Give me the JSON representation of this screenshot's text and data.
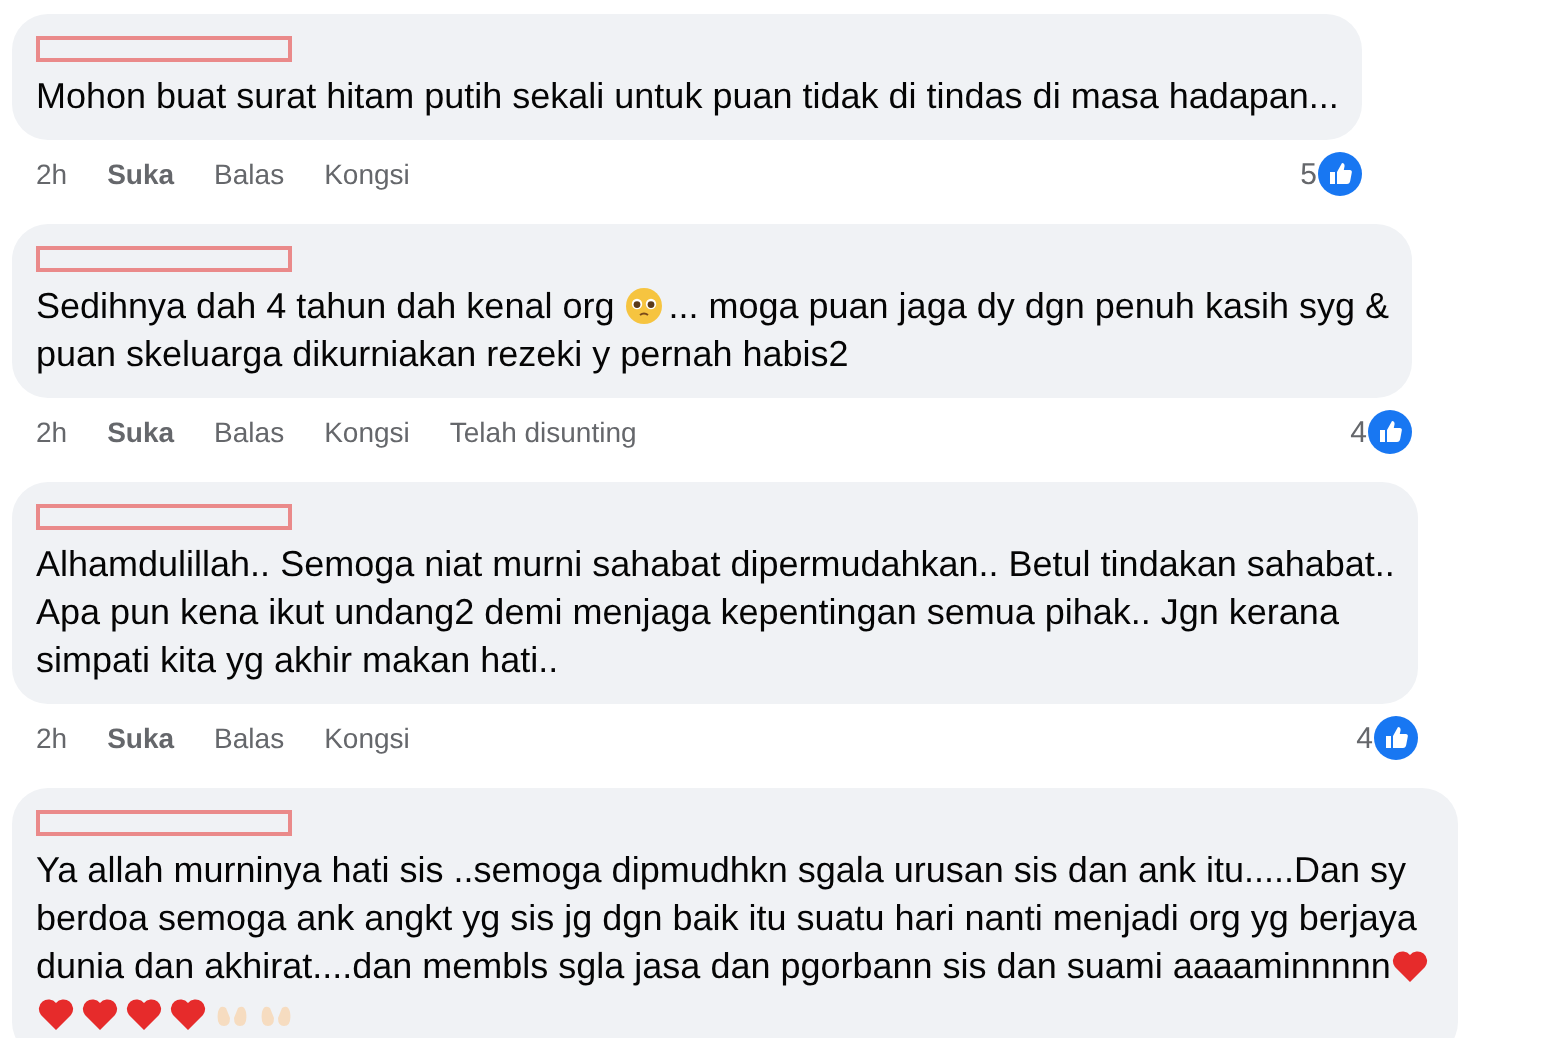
{
  "comments": [
    {
      "lines": [
        [
          {
            "kind": "text",
            "text": "Mohon buat surat hitam putih sekali untuk puan tidak di tindas di masa hadapan..."
          }
        ]
      ],
      "time": "2h",
      "actions": [
        "Suka",
        "Balas",
        "Kongsi"
      ],
      "reaction_count": "5"
    },
    {
      "lines": [
        [
          {
            "kind": "text",
            "text": "Sedihnya dah 4 tahun dah kenal org"
          },
          {
            "kind": "pleading-emoji"
          },
          {
            "kind": "text",
            "text": "... moga puan jaga dy dgn penuh kasih syg &"
          }
        ],
        [
          {
            "kind": "text",
            "text": "puan skeluarga dikurniakan rezeki y pernah habis2"
          }
        ]
      ],
      "time": "2h",
      "actions": [
        "Suka",
        "Balas",
        "Kongsi"
      ],
      "edited": "Telah disunting",
      "reaction_count": "4"
    },
    {
      "lines": [
        [
          {
            "kind": "text",
            "text": "Alhamdulillah.. Semoga niat murni sahabat dipermudahkan.. Betul tindakan sahabat.."
          }
        ],
        [
          {
            "kind": "text",
            "text": "Apa pun kena ikut undang2 demi menjaga kepentingan semua pihak.. Jgn kerana"
          }
        ],
        [
          {
            "kind": "text",
            "text": "simpati kita yg akhir makan hati.."
          }
        ]
      ],
      "time": "2h",
      "actions": [
        "Suka",
        "Balas",
        "Kongsi"
      ],
      "reaction_count": "4"
    },
    {
      "lines": [
        [
          {
            "kind": "text",
            "text": "Ya allah murninya hati sis ..semoga dipmudhkn sgala urusan sis dan ank itu.....Dan sy"
          }
        ],
        [
          {
            "kind": "text",
            "text": "berdoa semoga ank angkt yg sis jg dgn baik itu suatu hari nanti menjadi org yg berjaya"
          }
        ],
        [
          {
            "kind": "text",
            "text": "dunia dan akhirat....dan membls sgla jasa dan pgorbann sis dan suami aaaaminnnnn"
          },
          {
            "kind": "heart-emoji"
          }
        ],
        [
          {
            "kind": "heart-emoji"
          },
          {
            "kind": "heart-emoji"
          },
          {
            "kind": "heart-emoji"
          },
          {
            "kind": "heart-emoji"
          },
          {
            "kind": "palms-emoji"
          },
          {
            "kind": "palms-emoji"
          }
        ]
      ]
    }
  ]
}
